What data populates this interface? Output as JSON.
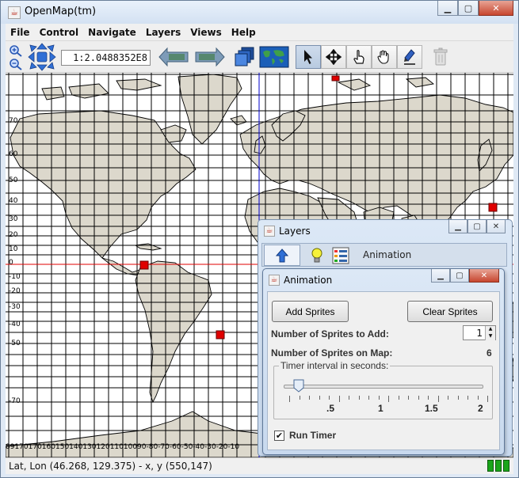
{
  "window": {
    "title": "OpenMap(tm)"
  },
  "menu": [
    "File",
    "Control",
    "Navigate",
    "Layers",
    "Views",
    "Help"
  ],
  "toolbar": {
    "scale": "1:2.0488352E8",
    "icons": [
      "zoom-in",
      "zoom-out",
      "pan-arrows",
      "back-map",
      "forward-map",
      "layers",
      "world-map",
      "select-arrow",
      "move-cross",
      "drag-hand",
      "pan-hand",
      "draw-pen",
      "delete-trash"
    ]
  },
  "map": {
    "lat_labels": [
      "70",
      "60",
      "50",
      "40",
      "30",
      "20",
      "10",
      "0",
      "-10",
      "-20",
      "-30",
      "-40",
      "-50",
      "-70"
    ],
    "lon_labels": "8917017016015014013012011010090-80-70-60-50-40-30-20-10"
  },
  "status": {
    "text": "Lat, Lon (46.268, 129.375) - x, y (550,147)"
  },
  "layers_window": {
    "title": "Layers",
    "tab_label": "Animation"
  },
  "animation_window": {
    "title": "Animation",
    "add_button": "Add Sprites",
    "clear_button": "Clear Sprites",
    "sprites_to_add_label": "Number of Sprites to Add:",
    "sprites_to_add_value": "1",
    "sprites_on_map_label": "Number of Sprites on Map:",
    "sprites_on_map_value": "6",
    "timer_label": "Timer interval in seconds:",
    "timer_value": 0.15,
    "slider_labels": [
      ".5",
      "1",
      "1.5",
      "2"
    ],
    "run_timer_label": "Run Timer",
    "run_timer_checked": true
  },
  "colors": {
    "land": "#dcd8cc",
    "sprite": "#e00000",
    "equator": "#e00000",
    "meridian": "#0000cc"
  }
}
